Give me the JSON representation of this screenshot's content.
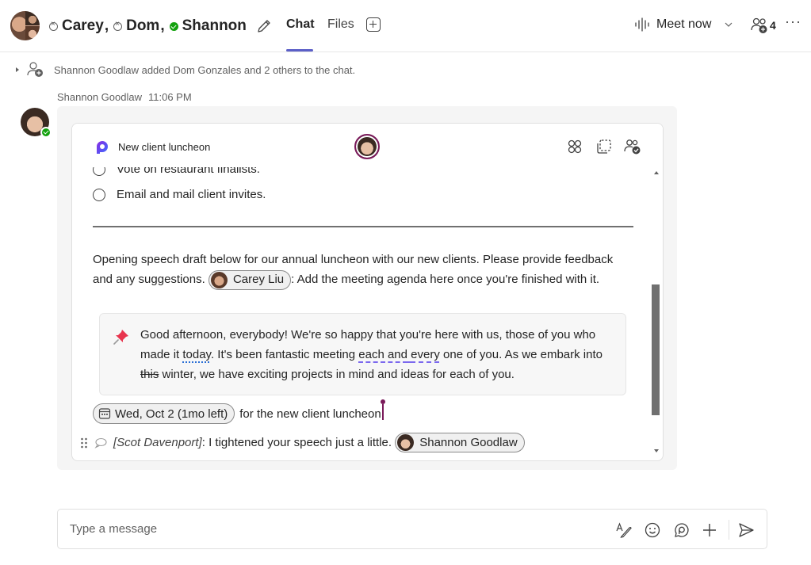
{
  "header": {
    "participants": [
      {
        "name": "Carey",
        "presence": "away"
      },
      {
        "name": "Dom",
        "presence": "away"
      },
      {
        "name": "Shannon",
        "presence": "available"
      }
    ],
    "separator": ",",
    "tabs": [
      {
        "label": "Chat",
        "active": true
      },
      {
        "label": "Files",
        "active": false
      }
    ],
    "meet_now_label": "Meet now",
    "participant_count": "4",
    "more_label": "···",
    "accent_color": "#5b5fc7"
  },
  "system_message": "Shannon Goodlaw added Dom Gonzales and 2 others to the chat.",
  "message": {
    "sender": "Shannon Goodlaw",
    "time": "11:06 PM",
    "card": {
      "title": "New client luncheon",
      "tasks": [
        "Vote on restaurant finalists.",
        "Email and mail client invites."
      ],
      "paragraph": {
        "before_mention": "Opening speech draft below for our annual luncheon with our new clients. Please provide feedback and any suggestions. ",
        "mention": "Carey Liu",
        "after_mention": ": Add the meeting agenda here once you're finished with it."
      },
      "quote": {
        "p1": "Good afternoon, everybody! We're so happy that you're here with us, those of you who made it ",
        "strike1": "today",
        "p2": ". It's been fantastic meeting ",
        "strike2": "each and",
        "p3": " ",
        "added": "every",
        "p4": " one of you. As we embark into ",
        "strike3": "this",
        "p5": " winter, we have exciting projects in mind and ideas for each of you."
      },
      "date_chip": "Wed, Oct 2 (1mo left)",
      "date_suffix": "for the new client luncheon",
      "comment": {
        "author": "[Scot Davenport]",
        "text": ": I tightened your speech just a little.",
        "mention": "Shannon Goodlaw"
      },
      "scroll_position": 0.55
    }
  },
  "composer": {
    "placeholder": "Type a message"
  }
}
